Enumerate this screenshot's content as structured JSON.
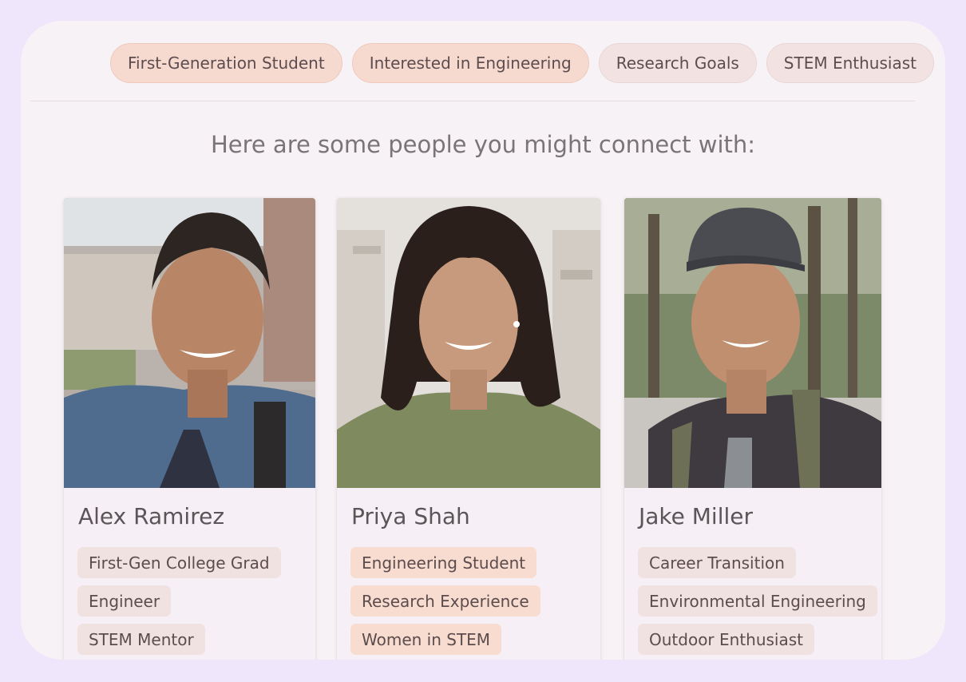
{
  "interest_tags": [
    {
      "label": "First-Generation Student",
      "selected": true
    },
    {
      "label": "Interested in Engineering",
      "selected": true
    },
    {
      "label": "Research Goals",
      "selected": false
    },
    {
      "label": "STEM Enthusiast",
      "selected": false
    }
  ],
  "heading": "Here are some people you might connect with:",
  "people": [
    {
      "name": "Alex Ramirez",
      "tags": [
        "First-Gen College Grad",
        "Engineer",
        "STEM Mentor"
      ]
    },
    {
      "name": "Priya Shah",
      "tags": [
        "Engineering Student",
        "Research Experience",
        "Women in STEM"
      ]
    },
    {
      "name": "Jake Miller",
      "tags": [
        "Career Transition",
        "Environmental Engineering",
        "Outdoor Enthusiast"
      ]
    }
  ],
  "colors": {
    "page_bg": "#efe6fb",
    "panel_bg": "#f7f2f5",
    "selected_tag": "#f6d9cf",
    "unselected_tag": "#f2e3e2",
    "peach_chip": "#f7dccf"
  }
}
